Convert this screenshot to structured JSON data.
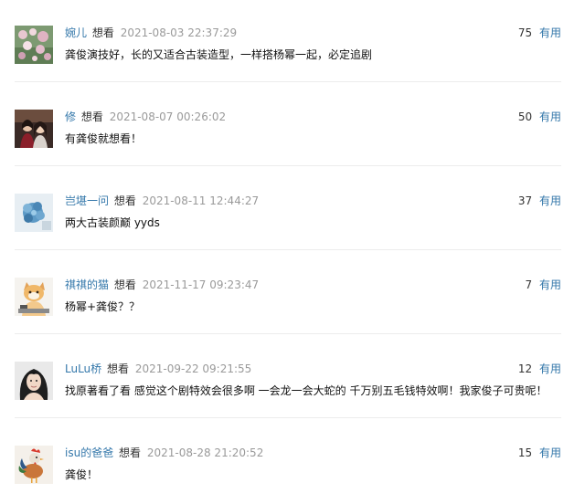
{
  "comments": [
    {
      "user": "婉儿",
      "status": "想看",
      "time": "2021-08-03 22:37:29",
      "votes": "75",
      "useful": "有用",
      "text": "龚俊演技好，长的又适合古装造型，一样搭杨幂一起，必定追剧",
      "avatar_icon": "flowers-avatar-icon"
    },
    {
      "user": "修",
      "status": "想看",
      "time": "2021-08-07 00:26:02",
      "votes": "50",
      "useful": "有用",
      "text": "有龚俊就想看！",
      "avatar_icon": "couple-avatar-icon"
    },
    {
      "user": "岂堪一问",
      "status": "想看",
      "time": "2021-08-11 12:44:27",
      "votes": "37",
      "useful": "有用",
      "text": "两大古装颜巅 yyds",
      "avatar_icon": "blue-flower-avatar-icon"
    },
    {
      "user": "祺祺的猫",
      "status": "想看",
      "time": "2021-11-17 09:23:47",
      "votes": "7",
      "useful": "有用",
      "text": "杨幂+龚俊？？",
      "avatar_icon": "cat-avatar-icon"
    },
    {
      "user": "LuLu桥",
      "status": "想看",
      "time": "2021-09-22 09:21:55",
      "votes": "12",
      "useful": "有用",
      "text": "找原著看了看 感觉这个剧特效会很多啊 一会龙一会大蛇的 千万别五毛钱特效啊！我家俊子可贵呢！",
      "avatar_icon": "portrait-avatar-icon"
    },
    {
      "user": "isu的爸爸",
      "status": "想看",
      "time": "2021-08-28 21:20:52",
      "votes": "15",
      "useful": "有用",
      "text": "龚俊！",
      "avatar_icon": "rooster-avatar-icon"
    }
  ]
}
